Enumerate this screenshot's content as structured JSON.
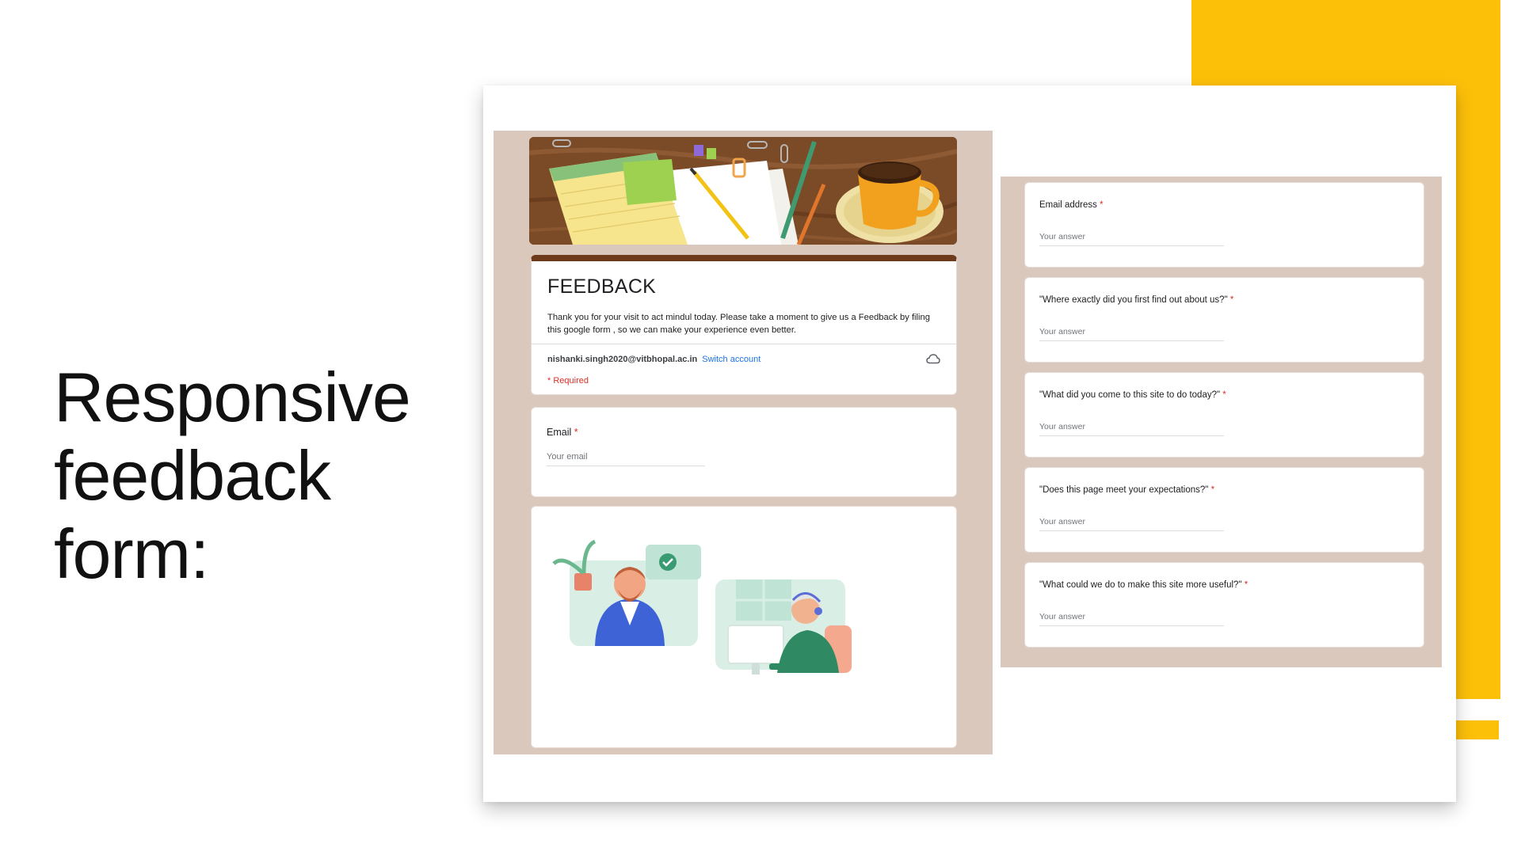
{
  "slide": {
    "title": "Responsive feedback form:",
    "accent_color": "#fdc009"
  },
  "form": {
    "title": "FEEDBACK",
    "description": "Thank you for your visit to act mindul today. Please take a moment to give us a Feedback by filing this google form , so we can make your experience even better.",
    "account_email": "nishanki.singh2020@vitbhopal.ac.in",
    "switch_account": "Switch account",
    "required_note": "* Required",
    "theme_color": "#6d3a1c",
    "background_color": "#dac8bd",
    "email_question": {
      "label": "Email",
      "required_mark": "*",
      "placeholder": "Your email"
    },
    "icons": [
      "cloud-icon"
    ]
  },
  "questions": [
    {
      "label": "Email address",
      "required_mark": "*",
      "placeholder": "Your answer"
    },
    {
      "label": "\"Where exactly did you first find out about us?\"",
      "required_mark": "*",
      "placeholder": "Your answer"
    },
    {
      "label": "\"What did you come to this site to do today?\"",
      "required_mark": "*",
      "placeholder": "Your answer"
    },
    {
      "label": "\"Does this page meet your expectations?\"",
      "required_mark": "*",
      "placeholder": "Your answer"
    },
    {
      "label": "\"What could we do to make this site more useful?\"",
      "required_mark": "*",
      "placeholder": "Your answer"
    }
  ]
}
